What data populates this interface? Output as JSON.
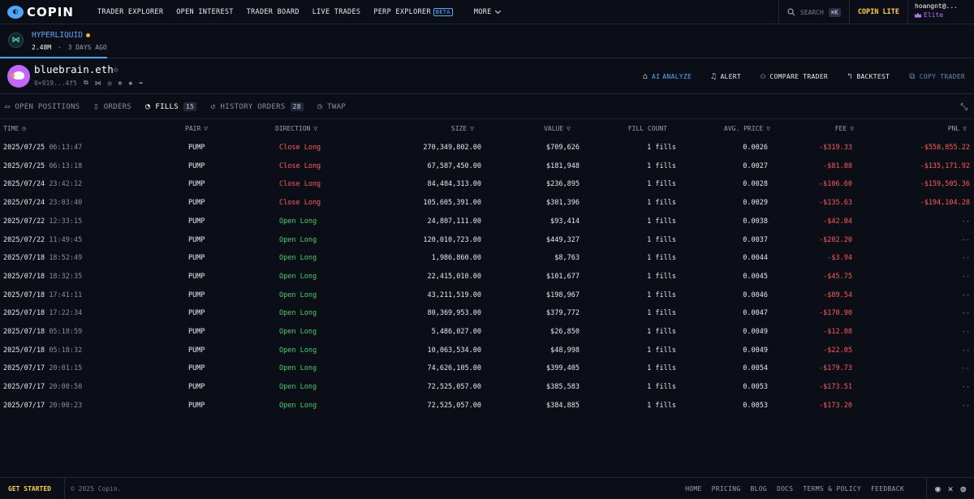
{
  "brand": {
    "name": "COPIN"
  },
  "nav": {
    "links": [
      "TRADER EXPLORER",
      "OPEN INTEREST",
      "TRADER BOARD",
      "LIVE TRADES",
      "PERP EXPLORER"
    ],
    "beta": "BETA",
    "more": "MORE",
    "search_label": "SEARCH",
    "search_shortcut": "⌘K",
    "lite": "COPIN LITE",
    "user_name": "hoangnt@...",
    "user_tier": "Elite"
  },
  "protocol": {
    "name": "HYPERLIQUID",
    "value": "2.48M",
    "separator": "·",
    "time": "3 DAYS AGO"
  },
  "trader": {
    "name": "bluebrain.eth",
    "address": "0×919...4f5",
    "actions": {
      "ai_prefix": "AI",
      "ai": "ANALYZE",
      "alert": "ALERT",
      "compare": "COMPARE TRADER",
      "backtest": "BACKTEST",
      "copy": "COPY TRADER"
    }
  },
  "tabs": {
    "open_positions": "OPEN POSITIONS",
    "orders": "ORDERS",
    "fills": "FILLS",
    "fills_count": "15",
    "history_orders": "HISTORY ORDERS",
    "history_count": "28",
    "twap": "TWAP"
  },
  "table": {
    "headers": {
      "time": "TIME",
      "pair": "PAIR",
      "direction": "DIRECTION",
      "size": "SIZE",
      "value": "VALUE",
      "fill_count": "FILL COUNT",
      "avg_price": "AVG. PRICE",
      "fee": "FEE",
      "pnl": "PNL"
    },
    "rows": [
      {
        "date": "2025/07/25",
        "time": "06:13:47",
        "pair": "PUMP",
        "direction": "Close Long",
        "size": "270,349,802.00",
        "value": "$709,626",
        "fills": "1 fills",
        "avg_price": "0.0026",
        "fee": "-$319.33",
        "pnl": "-$558,855.22"
      },
      {
        "date": "2025/07/25",
        "time": "06:13:18",
        "pair": "PUMP",
        "direction": "Close Long",
        "size": "67,587,450.00",
        "value": "$181,948",
        "fills": "1 fills",
        "avg_price": "0.0027",
        "fee": "-$81.88",
        "pnl": "-$135,171.92"
      },
      {
        "date": "2025/07/24",
        "time": "23:42:12",
        "pair": "PUMP",
        "direction": "Close Long",
        "size": "84,484,313.00",
        "value": "$236,895",
        "fills": "1 fills",
        "avg_price": "0.0028",
        "fee": "-$106.60",
        "pnl": "-$159,505.36"
      },
      {
        "date": "2025/07/24",
        "time": "23:03:40",
        "pair": "PUMP",
        "direction": "Close Long",
        "size": "105,605,391.00",
        "value": "$301,396",
        "fills": "1 fills",
        "avg_price": "0.0029",
        "fee": "-$135.63",
        "pnl": "-$194,104.28"
      },
      {
        "date": "2025/07/22",
        "time": "12:33:15",
        "pair": "PUMP",
        "direction": "Open Long",
        "size": "24,807,111.00",
        "value": "$93,414",
        "fills": "1 fills",
        "avg_price": "0.0038",
        "fee": "-$42.04",
        "pnl": "--"
      },
      {
        "date": "2025/07/22",
        "time": "11:49:45",
        "pair": "PUMP",
        "direction": "Open Long",
        "size": "120,010,723.00",
        "value": "$449,327",
        "fills": "1 fills",
        "avg_price": "0.0037",
        "fee": "-$202.20",
        "pnl": "--"
      },
      {
        "date": "2025/07/18",
        "time": "18:52:49",
        "pair": "PUMP",
        "direction": "Open Long",
        "size": "1,986,860.00",
        "value": "$8,763",
        "fills": "1 fills",
        "avg_price": "0.0044",
        "fee": "-$3.94",
        "pnl": "--"
      },
      {
        "date": "2025/07/18",
        "time": "18:32:35",
        "pair": "PUMP",
        "direction": "Open Long",
        "size": "22,415,010.00",
        "value": "$101,677",
        "fills": "1 fills",
        "avg_price": "0.0045",
        "fee": "-$45.75",
        "pnl": "--"
      },
      {
        "date": "2025/07/18",
        "time": "17:41:11",
        "pair": "PUMP",
        "direction": "Open Long",
        "size": "43,211,519.00",
        "value": "$198,967",
        "fills": "1 fills",
        "avg_price": "0.0046",
        "fee": "-$89.54",
        "pnl": "--"
      },
      {
        "date": "2025/07/18",
        "time": "17:22:34",
        "pair": "PUMP",
        "direction": "Open Long",
        "size": "80,369,953.00",
        "value": "$379,772",
        "fills": "1 fills",
        "avg_price": "0.0047",
        "fee": "-$170.90",
        "pnl": "--"
      },
      {
        "date": "2025/07/18",
        "time": "05:18:59",
        "pair": "PUMP",
        "direction": "Open Long",
        "size": "5,486,027.00",
        "value": "$26,850",
        "fills": "1 fills",
        "avg_price": "0.0049",
        "fee": "-$12.08",
        "pnl": "--"
      },
      {
        "date": "2025/07/18",
        "time": "05:18:32",
        "pair": "PUMP",
        "direction": "Open Long",
        "size": "10,063,534.00",
        "value": "$48,998",
        "fills": "1 fills",
        "avg_price": "0.0049",
        "fee": "-$22.05",
        "pnl": "--"
      },
      {
        "date": "2025/07/17",
        "time": "20:01:15",
        "pair": "PUMP",
        "direction": "Open Long",
        "size": "74,626,105.00",
        "value": "$399,405",
        "fills": "1 fills",
        "avg_price": "0.0054",
        "fee": "-$179.73",
        "pnl": "--"
      },
      {
        "date": "2025/07/17",
        "time": "20:00:50",
        "pair": "PUMP",
        "direction": "Open Long",
        "size": "72,525,057.00",
        "value": "$385,583",
        "fills": "1 fills",
        "avg_price": "0.0053",
        "fee": "-$173.51",
        "pnl": "--"
      },
      {
        "date": "2025/07/17",
        "time": "20:00:23",
        "pair": "PUMP",
        "direction": "Open Long",
        "size": "72,525,057.00",
        "value": "$384,885",
        "fills": "1 fills",
        "avg_price": "0.0053",
        "fee": "-$173.20",
        "pnl": "--"
      }
    ]
  },
  "footer": {
    "get_started": "GET STARTED",
    "copyright": "© 2025 Copin.",
    "links": [
      "HOME",
      "PRICING",
      "BLOG",
      "DOCS",
      "TERMS & POLICY",
      "FEEDBACK"
    ]
  },
  "colors": {
    "accent": "#4ea6ff",
    "negative": "#ff5c5c",
    "positive": "#3fcf6d",
    "warning": "#ffd24a",
    "elite": "#b37cff"
  },
  "icons": {
    "logo": "copin-logo-icon",
    "search": "search-icon",
    "star": "star-icon",
    "copy": "copy-icon",
    "alert": "bell-icon",
    "compare": "users-icon",
    "backtest": "backtest-icon",
    "copy_trader": "copy-trader-icon",
    "filter": "filter-icon",
    "clock": "clock-icon",
    "expand": "expand-icon",
    "discord": "discord-icon",
    "x": "x-icon",
    "github": "github-icon"
  }
}
